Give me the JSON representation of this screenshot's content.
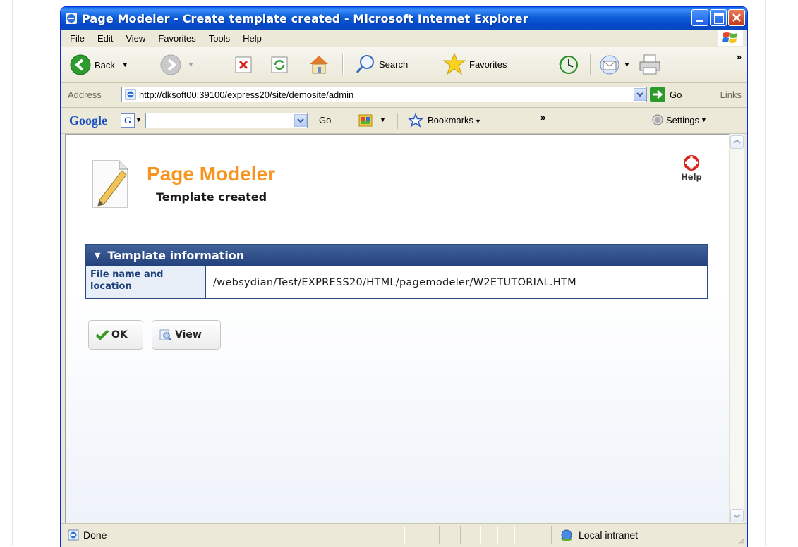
{
  "window": {
    "title": "Page Modeler - Create template created - Microsoft Internet Explorer"
  },
  "menu": {
    "items": [
      "File",
      "Edit",
      "View",
      "Favorites",
      "Tools",
      "Help"
    ]
  },
  "toolbar": {
    "back_label": "Back",
    "search_label": "Search",
    "favorites_label": "Favorites",
    "overflow": "»"
  },
  "address": {
    "label": "Address",
    "url": "http://dksoft00:39100/express20/site/demosite/admin",
    "go_label": "Go",
    "links_label": "Links"
  },
  "google": {
    "logo": "Google",
    "go_label": "Go",
    "bookmarks_label": "Bookmarks",
    "overflow": "»",
    "settings_label": "Settings"
  },
  "page": {
    "title": "Page Modeler",
    "subtitle": "Template created",
    "help_label": "Help",
    "panel": {
      "header": "Template information",
      "rows": [
        {
          "label": "File name and location",
          "value": "/websydian/Test/EXPRESS20/HTML/pagemodeler/W2ETUTORIAL.HTM"
        }
      ]
    },
    "buttons": {
      "ok_label": "OK",
      "view_label": "View"
    }
  },
  "status": {
    "text": "Done",
    "zone": "Local intranet"
  },
  "colors": {
    "title_bar": "#0a5fe6",
    "page_title": "#f7941d",
    "panel_header": "#23427d",
    "label_text": "#1f3f7a"
  }
}
